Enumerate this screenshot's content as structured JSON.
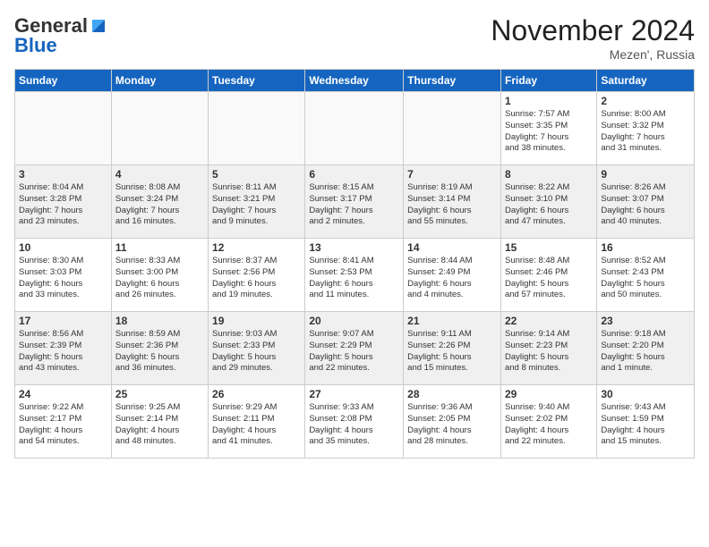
{
  "header": {
    "logo_general": "General",
    "logo_blue": "Blue",
    "month_title": "November 2024",
    "location": "Mezen', Russia"
  },
  "days_of_week": [
    "Sunday",
    "Monday",
    "Tuesday",
    "Wednesday",
    "Thursday",
    "Friday",
    "Saturday"
  ],
  "weeks": [
    {
      "shaded": false,
      "days": [
        {
          "num": "",
          "info": ""
        },
        {
          "num": "",
          "info": ""
        },
        {
          "num": "",
          "info": ""
        },
        {
          "num": "",
          "info": ""
        },
        {
          "num": "",
          "info": ""
        },
        {
          "num": "1",
          "info": "Sunrise: 7:57 AM\nSunset: 3:35 PM\nDaylight: 7 hours\nand 38 minutes."
        },
        {
          "num": "2",
          "info": "Sunrise: 8:00 AM\nSunset: 3:32 PM\nDaylight: 7 hours\nand 31 minutes."
        }
      ]
    },
    {
      "shaded": true,
      "days": [
        {
          "num": "3",
          "info": "Sunrise: 8:04 AM\nSunset: 3:28 PM\nDaylight: 7 hours\nand 23 minutes."
        },
        {
          "num": "4",
          "info": "Sunrise: 8:08 AM\nSunset: 3:24 PM\nDaylight: 7 hours\nand 16 minutes."
        },
        {
          "num": "5",
          "info": "Sunrise: 8:11 AM\nSunset: 3:21 PM\nDaylight: 7 hours\nand 9 minutes."
        },
        {
          "num": "6",
          "info": "Sunrise: 8:15 AM\nSunset: 3:17 PM\nDaylight: 7 hours\nand 2 minutes."
        },
        {
          "num": "7",
          "info": "Sunrise: 8:19 AM\nSunset: 3:14 PM\nDaylight: 6 hours\nand 55 minutes."
        },
        {
          "num": "8",
          "info": "Sunrise: 8:22 AM\nSunset: 3:10 PM\nDaylight: 6 hours\nand 47 minutes."
        },
        {
          "num": "9",
          "info": "Sunrise: 8:26 AM\nSunset: 3:07 PM\nDaylight: 6 hours\nand 40 minutes."
        }
      ]
    },
    {
      "shaded": false,
      "days": [
        {
          "num": "10",
          "info": "Sunrise: 8:30 AM\nSunset: 3:03 PM\nDaylight: 6 hours\nand 33 minutes."
        },
        {
          "num": "11",
          "info": "Sunrise: 8:33 AM\nSunset: 3:00 PM\nDaylight: 6 hours\nand 26 minutes."
        },
        {
          "num": "12",
          "info": "Sunrise: 8:37 AM\nSunset: 2:56 PM\nDaylight: 6 hours\nand 19 minutes."
        },
        {
          "num": "13",
          "info": "Sunrise: 8:41 AM\nSunset: 2:53 PM\nDaylight: 6 hours\nand 11 minutes."
        },
        {
          "num": "14",
          "info": "Sunrise: 8:44 AM\nSunset: 2:49 PM\nDaylight: 6 hours\nand 4 minutes."
        },
        {
          "num": "15",
          "info": "Sunrise: 8:48 AM\nSunset: 2:46 PM\nDaylight: 5 hours\nand 57 minutes."
        },
        {
          "num": "16",
          "info": "Sunrise: 8:52 AM\nSunset: 2:43 PM\nDaylight: 5 hours\nand 50 minutes."
        }
      ]
    },
    {
      "shaded": true,
      "days": [
        {
          "num": "17",
          "info": "Sunrise: 8:56 AM\nSunset: 2:39 PM\nDaylight: 5 hours\nand 43 minutes."
        },
        {
          "num": "18",
          "info": "Sunrise: 8:59 AM\nSunset: 2:36 PM\nDaylight: 5 hours\nand 36 minutes."
        },
        {
          "num": "19",
          "info": "Sunrise: 9:03 AM\nSunset: 2:33 PM\nDaylight: 5 hours\nand 29 minutes."
        },
        {
          "num": "20",
          "info": "Sunrise: 9:07 AM\nSunset: 2:29 PM\nDaylight: 5 hours\nand 22 minutes."
        },
        {
          "num": "21",
          "info": "Sunrise: 9:11 AM\nSunset: 2:26 PM\nDaylight: 5 hours\nand 15 minutes."
        },
        {
          "num": "22",
          "info": "Sunrise: 9:14 AM\nSunset: 2:23 PM\nDaylight: 5 hours\nand 8 minutes."
        },
        {
          "num": "23",
          "info": "Sunrise: 9:18 AM\nSunset: 2:20 PM\nDaylight: 5 hours\nand 1 minute."
        }
      ]
    },
    {
      "shaded": false,
      "days": [
        {
          "num": "24",
          "info": "Sunrise: 9:22 AM\nSunset: 2:17 PM\nDaylight: 4 hours\nand 54 minutes."
        },
        {
          "num": "25",
          "info": "Sunrise: 9:25 AM\nSunset: 2:14 PM\nDaylight: 4 hours\nand 48 minutes."
        },
        {
          "num": "26",
          "info": "Sunrise: 9:29 AM\nSunset: 2:11 PM\nDaylight: 4 hours\nand 41 minutes."
        },
        {
          "num": "27",
          "info": "Sunrise: 9:33 AM\nSunset: 2:08 PM\nDaylight: 4 hours\nand 35 minutes."
        },
        {
          "num": "28",
          "info": "Sunrise: 9:36 AM\nSunset: 2:05 PM\nDaylight: 4 hours\nand 28 minutes."
        },
        {
          "num": "29",
          "info": "Sunrise: 9:40 AM\nSunset: 2:02 PM\nDaylight: 4 hours\nand 22 minutes."
        },
        {
          "num": "30",
          "info": "Sunrise: 9:43 AM\nSunset: 1:59 PM\nDaylight: 4 hours\nand 15 minutes."
        }
      ]
    }
  ]
}
